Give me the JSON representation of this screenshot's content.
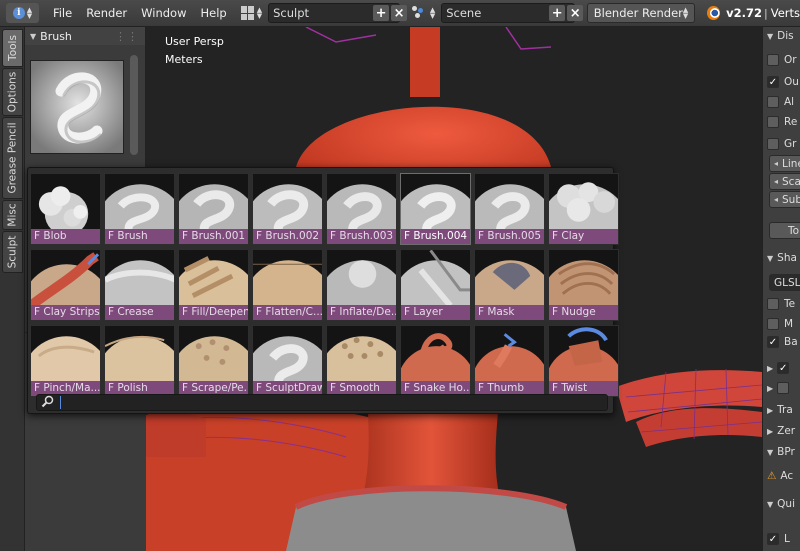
{
  "header": {
    "menus": [
      "File",
      "Render",
      "Window",
      "Help"
    ],
    "layout_name": "Sculpt",
    "scene_name": "Scene",
    "renderer": "Blender Render",
    "version": "v2.72",
    "stats_fragment": "Verts"
  },
  "left_tabs": [
    "Tools",
    "Options",
    "Grease Pencil",
    "Misc",
    "Sculpt"
  ],
  "toolshelf": {
    "panel_title": "Brush"
  },
  "viewport": {
    "view_label": "User Persp",
    "units_label": "Meters"
  },
  "brush_popup": {
    "search_text": "",
    "brushes": [
      {
        "label": "F Blob",
        "selected": false
      },
      {
        "label": "F Brush",
        "selected": false
      },
      {
        "label": "F Brush.001",
        "selected": false
      },
      {
        "label": "F Brush.002",
        "selected": false
      },
      {
        "label": "F Brush.003",
        "selected": false
      },
      {
        "label": "F Brush.004",
        "selected": true
      },
      {
        "label": "F Brush.005",
        "selected": false
      },
      {
        "label": "F Clay",
        "selected": false
      },
      {
        "label": "F Clay Strips",
        "selected": false
      },
      {
        "label": "F Crease",
        "selected": false
      },
      {
        "label": "F Fill/Deepen",
        "selected": false
      },
      {
        "label": "F Flatten/C...",
        "selected": false
      },
      {
        "label": "F Inflate/De...",
        "selected": false
      },
      {
        "label": "F Layer",
        "selected": false
      },
      {
        "label": "F Mask",
        "selected": false
      },
      {
        "label": "F Nudge",
        "selected": false
      },
      {
        "label": "F Pinch/Ma...",
        "selected": false
      },
      {
        "label": "F Polish",
        "selected": false
      },
      {
        "label": "F Scrape/Pe...",
        "selected": false
      },
      {
        "label": "F SculptDraw",
        "selected": false
      },
      {
        "label": "F Smooth",
        "selected": false
      },
      {
        "label": "F Snake Ho...",
        "selected": false
      },
      {
        "label": "F Thumb",
        "selected": false
      },
      {
        "label": "F Twist",
        "selected": false
      }
    ]
  },
  "properties": {
    "rows": [
      "Dis",
      "Or",
      "Ou",
      "Al",
      "Re",
      "Gr",
      "Line",
      "Sca",
      "Sub",
      "To",
      "Sha",
      "GLSL",
      "Te",
      "M",
      "Ba",
      "",
      "",
      "Tra",
      "Zer",
      "BPr",
      "Ac",
      "Qui",
      "L"
    ]
  },
  "colors": {
    "accent_label": "#7d4a7b",
    "mesh_red": "#d8452a",
    "search_caret": "#5a8be0"
  }
}
